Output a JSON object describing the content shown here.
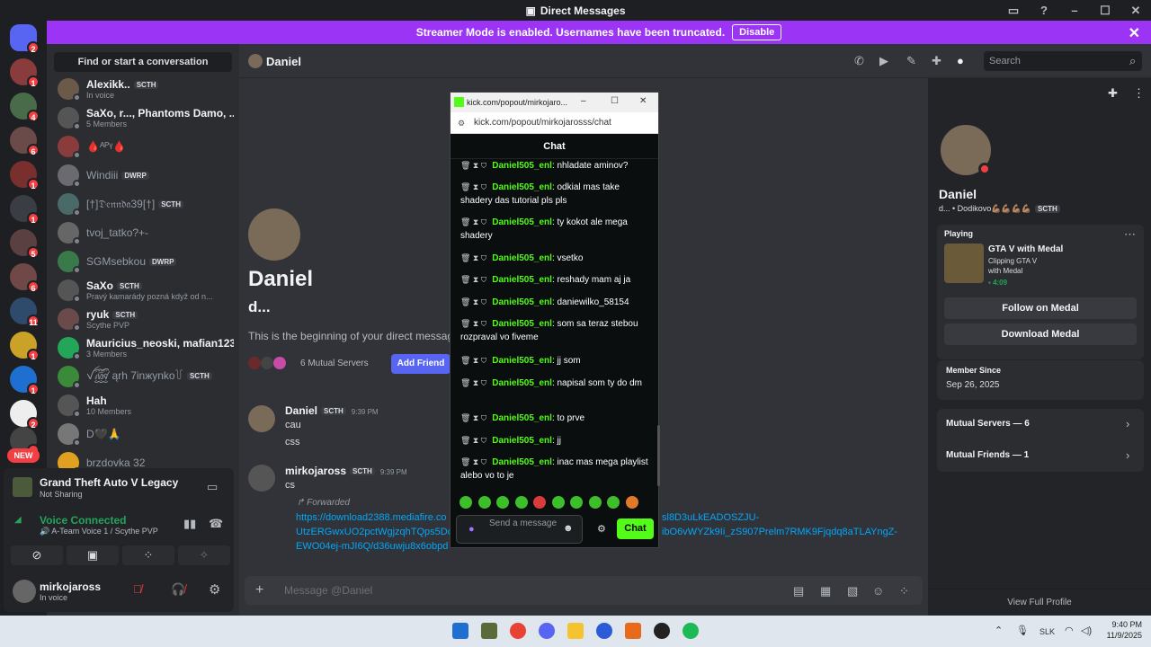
{
  "window": {
    "title": "Direct Messages"
  },
  "banner": {
    "text": "Streamer Mode is enabled. Usernames have been truncated.",
    "button": "Disable"
  },
  "rail": {
    "badges": [
      "2",
      "1",
      "4",
      "6",
      "1",
      "1",
      "5",
      "6",
      "11",
      "1",
      "1",
      "2",
      "1"
    ],
    "new_label": "NEW"
  },
  "sidebar": {
    "find": "Find or start a conversation",
    "dms": [
      {
        "name": "Alexikk..",
        "tag": "SCTH",
        "sub": "In voice"
      },
      {
        "name": "SaXo, r..., Phantoms Damo, ...",
        "sub": "5 Members"
      },
      {
        "name": "🩸ᴬᴾᵞ🩸"
      },
      {
        "name": "Windiii",
        "tag": "DWRP"
      },
      {
        "name": "[†]𝔇𝔢𝔫𝔫𝔡𝔞39[†]",
        "tag": "SCTH"
      },
      {
        "name": "tvoj_tatko?+-"
      },
      {
        "name": "SGMsebkou",
        "tag": "DWRP"
      },
      {
        "name": "SaXo",
        "tag": "SCTH",
        "sub": "Pravý kamarády pozná když od n..."
      },
      {
        "name": "ryuk",
        "tag": "SCTH",
        "sub": "Scythe PVP"
      },
      {
        "name": "Mauricius_neoski, mafian123",
        "sub": "3 Members"
      },
      {
        "name": "ꪜ꫞ ąrh 7inжynko꒦",
        "tag": "SCTH"
      },
      {
        "name": "Hah",
        "sub": "10 Members"
      },
      {
        "name": "D🖤🙏"
      },
      {
        "name": "brzdovka 32"
      }
    ]
  },
  "activity": {
    "game": "Grand Theft Auto V Legacy",
    "status": "Not Sharing"
  },
  "voice": {
    "title": "Voice Connected",
    "channel": "A-Team Voice 1 / Scythe PVP"
  },
  "user": {
    "name": "mirkojaross",
    "status": "In voice"
  },
  "header": {
    "name": "Daniel",
    "search_placeholder": "Search"
  },
  "intro": {
    "big_name": "Daniel",
    "handle": "d...",
    "text": "This is the beginning of your direct message h",
    "mutual": "6 Mutual Servers",
    "add_friend": "Add Friend"
  },
  "messages": [
    {
      "author": "Daniel",
      "tag": "SCTH",
      "time": "9:39 PM",
      "lines": [
        "cau",
        "css"
      ]
    },
    {
      "author": "mirkojaross",
      "tag": "SCTH",
      "time": "9:39 PM",
      "lines": [
        "cs"
      ],
      "forwarded": "Forwarded",
      "link1": "https://download2388.mediafire.co",
      "link1b": "sl8D3uLkEADOSZJU-",
      "link2": "UtzERGwxUO2pctWgjzqhTQps5Dci",
      "link2b": "ibO6vWYZk9Ii_zS907Prelm7RMK9Fjqdq8aTLAYngZ-",
      "link3": "EWO04ej-mJI6Q/d36uwju8x6obpd"
    }
  ],
  "composer": {
    "placeholder": "Message @Daniel"
  },
  "kick": {
    "tab_title": "kick.com/popout/mirkojaro...",
    "url": "kick.com/popout/mirkojarosss/chat",
    "header": "Chat",
    "messages": [
      {
        "user": "Daniel505_enl",
        "text": ": nhladate aminov?"
      },
      {
        "user": "Daniel505_enl",
        "text": ": odkial mas take shadery das tutorial pls pls"
      },
      {
        "user": "Daniel505_enl",
        "text": ": ty kokot ale mega shadery"
      },
      {
        "user": "Daniel505_enl",
        "text": ": vsetko"
      },
      {
        "user": "Daniel505_enl",
        "text": ": reshady mam aj ja"
      },
      {
        "user": "Daniel505_enl",
        "text": ": daniewilko_58154"
      },
      {
        "user": "Daniel505_enl",
        "text": ": som sa teraz stebou rozpraval vo fiveme"
      },
      {
        "user": "Daniel505_enl",
        "text": ": jj som"
      },
      {
        "user": "Daniel505_enl",
        "text": ": napisal som ty do dm"
      },
      {
        "user": "Daniel505_enl",
        "text": ": to prve"
      },
      {
        "user": "Daniel505_enl",
        "text": ": jj"
      },
      {
        "user": "Daniel505_enl",
        "text": ": inac mas mega playlist alebo vo to je"
      }
    ],
    "input_placeholder": "Send a message",
    "chat_button": "Chat"
  },
  "profile": {
    "name": "Daniel",
    "handle": "d...",
    "status": "• Dodikovo💪🏽💪🏽💪🏽💪🏽",
    "tag": "SCTH",
    "playing_label": "Playing",
    "game": "GTA V with Medal",
    "game_sub1": "Clipping GTA V",
    "game_sub2": "with Medal",
    "game_time": "4:09",
    "follow": "Follow on Medal",
    "download": "Download Medal",
    "member_since_label": "Member Since",
    "member_since": "Sep 26, 2025",
    "mutual_servers": "Mutual Servers — 6",
    "mutual_friends": "Mutual Friends — 1",
    "view_full": "View Full Profile"
  },
  "taskbar": {
    "lang": "SLK",
    "time": "9:40 PM",
    "date": "11/9/2025"
  },
  "colors": {
    "discord_purple": "#5865f2",
    "streamer_banner": "#9b34f5",
    "kick_green": "#53fc18",
    "voice_green": "#23a55a"
  }
}
